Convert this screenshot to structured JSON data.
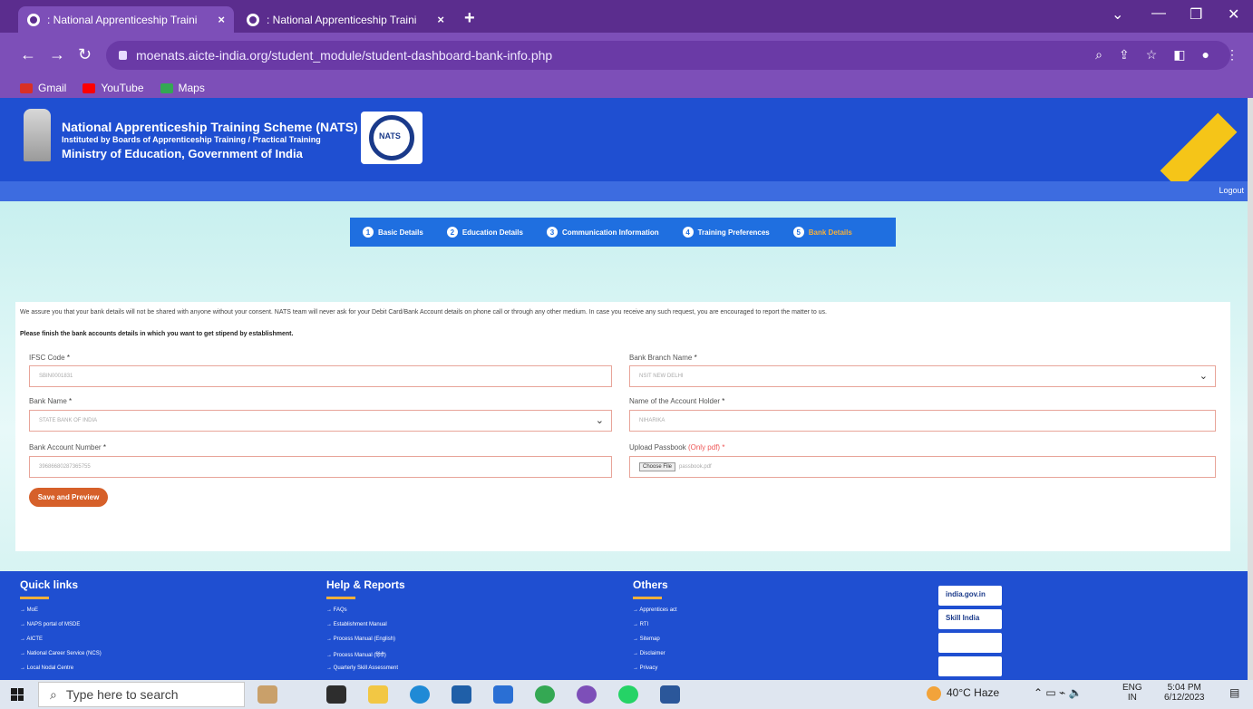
{
  "browser": {
    "tabs": [
      {
        "title": ": National Apprenticeship Traini",
        "active": true
      },
      {
        "title": ": National Apprenticeship Traini",
        "active": false
      }
    ],
    "new_tab": "+",
    "url": "moenats.aicte-india.org/student_module/student-dashboard-bank-info.php",
    "bookmarks": [
      {
        "label": "Gmail",
        "color": "#d93025"
      },
      {
        "label": "YouTube",
        "color": "#ff0000"
      },
      {
        "label": "Maps",
        "color": "#34a853"
      }
    ]
  },
  "header": {
    "title": "National Apprenticeship Training Scheme (NATS)",
    "subtitle": "Instituted by Boards of Apprenticeship Training / Practical Training",
    "ministry": "Ministry of Education, Government of India",
    "logo_text": "NATS",
    "logout": "Logout"
  },
  "steps": [
    {
      "num": "1",
      "label": "Basic Details"
    },
    {
      "num": "2",
      "label": "Education Details"
    },
    {
      "num": "3",
      "label": "Communication Information"
    },
    {
      "num": "4",
      "label": "Training Preferences"
    },
    {
      "num": "5",
      "label": "Bank Details",
      "active": true
    }
  ],
  "form": {
    "notice": "We assure you that your bank details will not be shared with anyone without your consent. NATS team will never ask for your Debit Card/Bank Account details on phone call or through any other medium. In case you receive any such request, you are encouraged to report the matter to us.",
    "instruction": "Please finish the bank accounts details in which you want to get stipend by establishment.",
    "ifsc": {
      "label": "IFSC Code",
      "req": "*",
      "value": "SBIN0001831"
    },
    "branch": {
      "label": "Bank Branch Name",
      "req": "*",
      "value": "NSIT NEW DELHI"
    },
    "bank_name": {
      "label": "Bank Name",
      "req": "*",
      "value": "STATE BANK OF INDIA"
    },
    "holder": {
      "label": "Name of the Account Holder",
      "req": "*",
      "value": "NIHARIKA"
    },
    "account": {
      "label": "Bank Account Number",
      "req": "*",
      "value": "39686680287365755"
    },
    "passbook": {
      "label": "Upload Passbook",
      "note": "(Only pdf)",
      "req": "*",
      "button": "Choose File",
      "file": "passbook.pdf"
    },
    "save": "Save and Preview"
  },
  "footer": {
    "quick_links": {
      "title": "Quick links",
      "items": [
        "MoE",
        "NAPS portal of MSDE",
        "AICTE",
        "National Career Service (NCS)",
        "Local Nodal Centre"
      ]
    },
    "help": {
      "title": "Help & Reports",
      "items": [
        "FAQs",
        "Establishment Manual",
        "Process Manual (English)",
        "Process Manual (हिंदी)",
        "Quarterly Skill Assessment"
      ]
    },
    "others": {
      "title": "Others",
      "items": [
        "Apprentices act",
        "RTI",
        "Sitemap",
        "Disclaimer",
        "Privacy"
      ]
    },
    "logos": [
      "india.gov.in",
      "Skill India",
      "",
      ""
    ]
  },
  "taskbar": {
    "search_placeholder": "Type here to search",
    "weather": "40°C Haze",
    "lang": "ENG",
    "region": "IN",
    "time": "5:04 PM",
    "date": "6/12/2023"
  }
}
